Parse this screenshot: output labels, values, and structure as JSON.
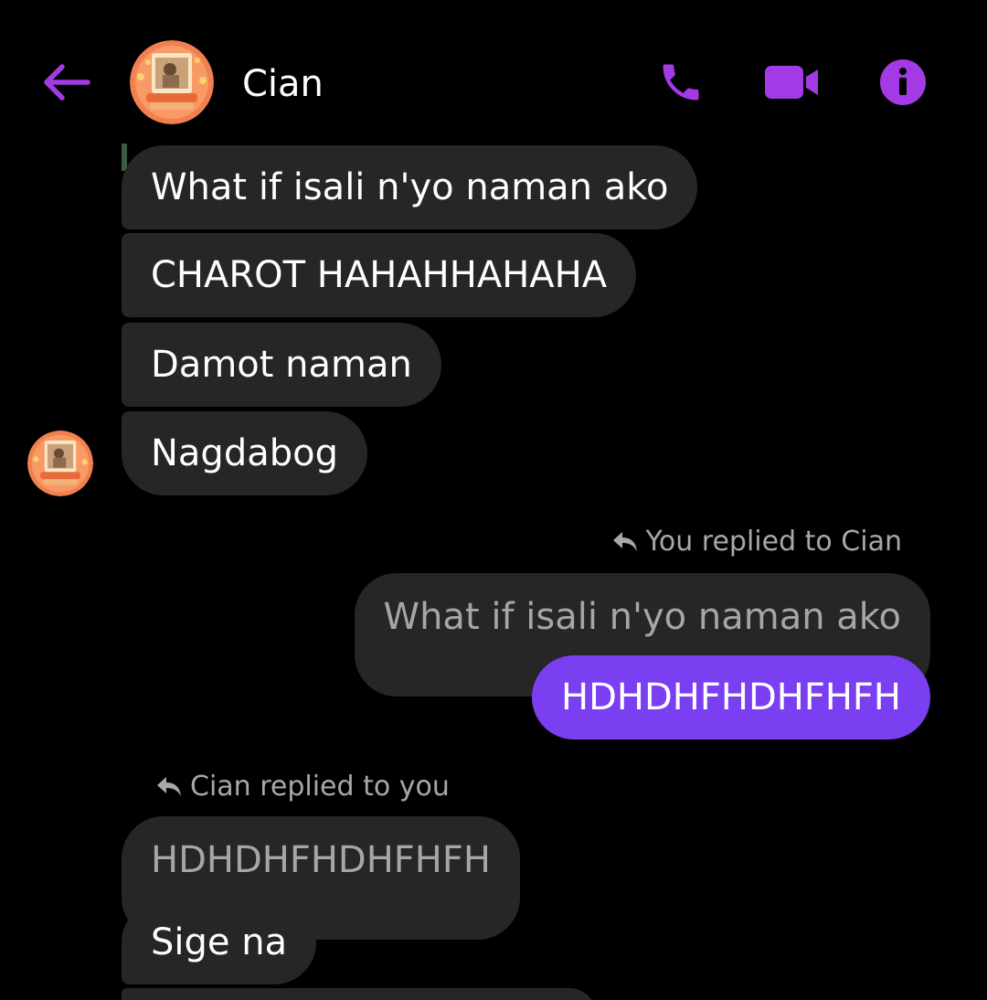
{
  "colors": {
    "accent": "#a43ae6",
    "outgoing_bubble": "#7b3ff2",
    "incoming_bubble": "#262626",
    "background": "#000000"
  },
  "header": {
    "contact_name": "Cian",
    "back_icon": "arrow-left-icon",
    "call_icon": "phone-icon",
    "video_icon": "video-camera-icon",
    "info_icon": "info-icon"
  },
  "messages": {
    "incoming_group_1": [
      "What if isali n'yo naman ako",
      "CHAROT HAHAHHAHAHA",
      "Damot naman",
      "Nagdabog"
    ],
    "my_reply": {
      "label": "You replied to Cian",
      "quoted": "What if isali n'yo naman ako",
      "text": "HDHDHFHDHFHFH"
    },
    "their_reply": {
      "label": "Cian replied to you",
      "quoted": "HDHDHFHDHFHFH",
      "text": "Sige na"
    }
  }
}
